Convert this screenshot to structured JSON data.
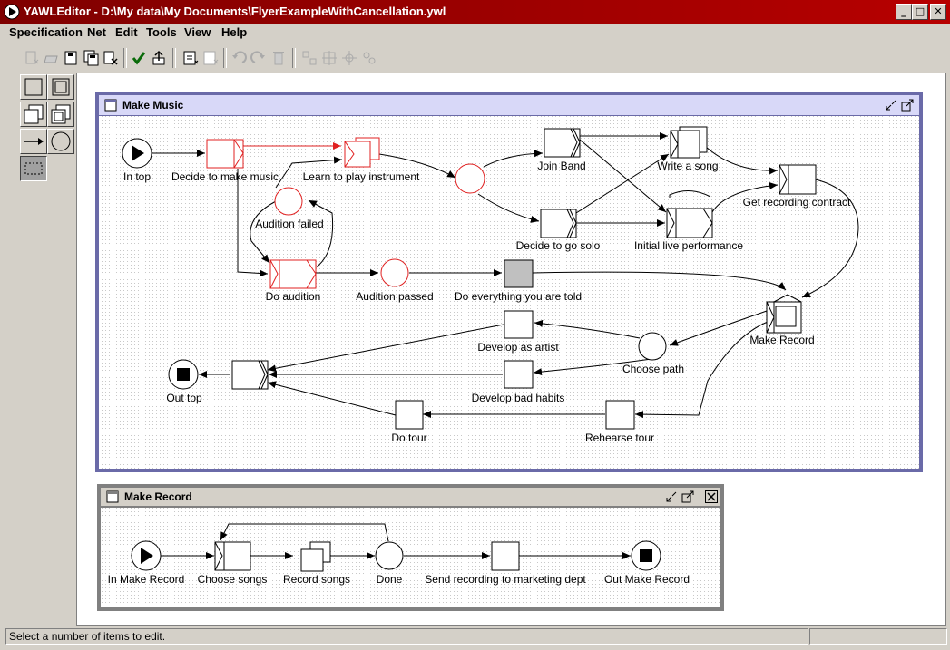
{
  "window": {
    "title": "YAWLEditor - D:\\My data\\My Documents\\FlyerExampleWithCancellation.ywl"
  },
  "menu": {
    "items": [
      "Specification",
      "Net",
      "Edit",
      "Tools",
      "View",
      "Help"
    ]
  },
  "status": {
    "text": "Select a number of items to edit."
  },
  "nets": {
    "make_music": {
      "title": "Make Music",
      "labels": {
        "in_top": "In top",
        "decide_music": "Decide to make music",
        "learn_instrument": "Learn to play instrument",
        "audition_failed": "Audition failed",
        "join_band": "Join Band",
        "write_song": "Write a song",
        "get_contract": "Get recording contract",
        "decide_solo": "Decide to go solo",
        "initial_live": "Initial live performance",
        "do_audition": "Do audition",
        "audition_passed": "Audition passed",
        "do_everything": "Do everything you are told",
        "make_record": "Make Record",
        "develop_artist": "Develop as artist",
        "choose_path": "Choose path",
        "out_top": "Out top",
        "develop_bad": "Develop bad habits",
        "do_tour": "Do tour",
        "rehearse_tour": "Rehearse tour"
      }
    },
    "make_record": {
      "title": "Make Record",
      "labels": {
        "in_make_record": "In Make Record",
        "choose_songs": "Choose songs",
        "record_songs": "Record songs",
        "done": "Done",
        "send_recording": "Send recording to marketing dept",
        "out_make_record": "Out Make Record"
      }
    }
  },
  "colors": {
    "title_bar": "#9b0000",
    "selection": "#e02020",
    "frame_border_active": "#6060a0",
    "frame_title_active": "#d0d0f8"
  },
  "icons": {
    "toolbar": [
      "new-spec-icon",
      "open-icon",
      "save-icon",
      "save-as-icon",
      "close-icon",
      "validate-icon",
      "export-icon",
      "add-net-icon",
      "remove-net-icon",
      "undo-icon",
      "redo-icon",
      "delete-icon",
      "align-icon",
      "align-center-icon",
      "zoom-icon",
      "properties-icon"
    ],
    "palette": [
      "atomic-task-icon",
      "composite-task-icon",
      "multiple-atomic-task-icon",
      "multiple-composite-task-icon",
      "flow-icon",
      "condition-icon",
      "marquee-icon"
    ]
  }
}
